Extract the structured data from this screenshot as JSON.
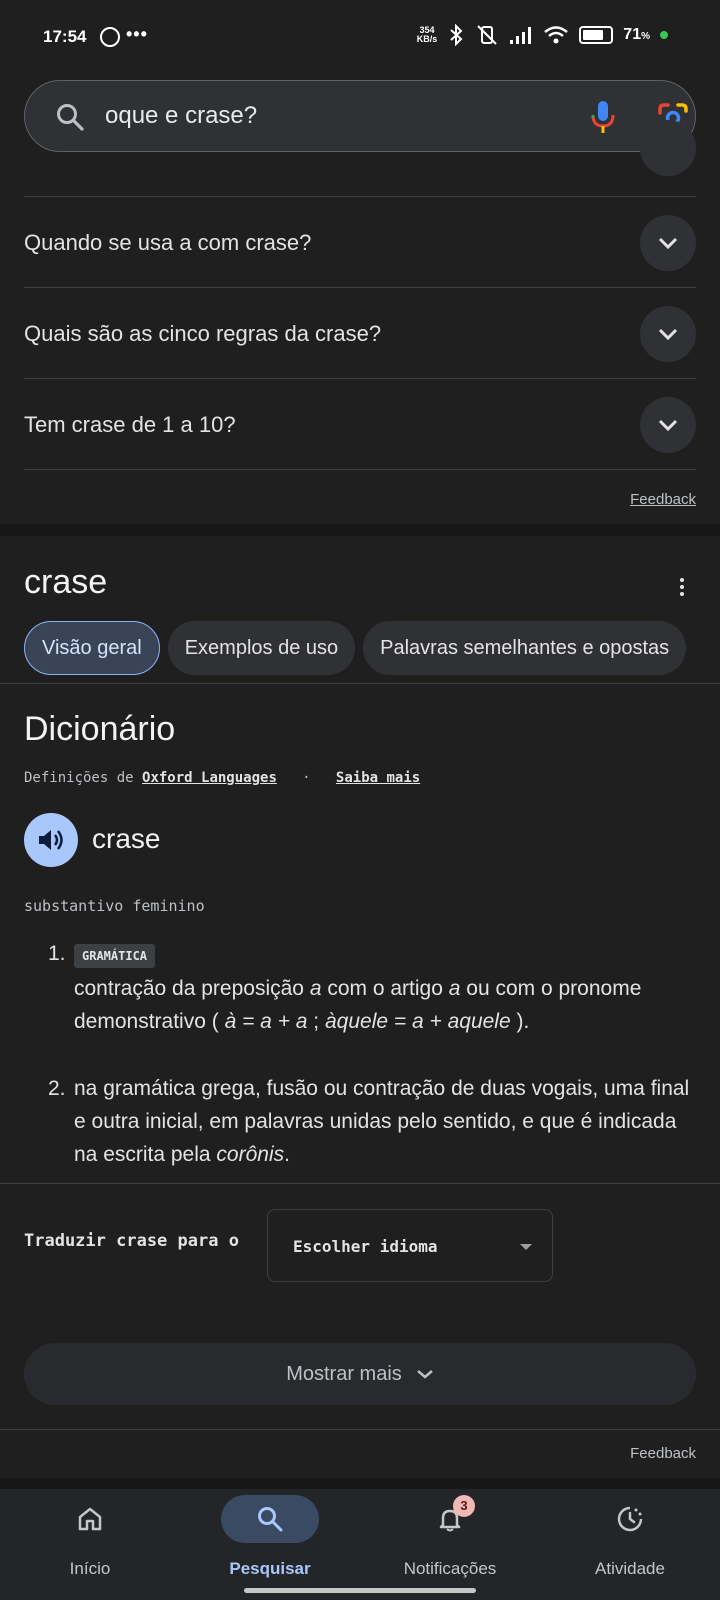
{
  "status_bar": {
    "time": "17:54",
    "dots": "•••",
    "speed_value": "354",
    "speed_unit": "KB/s",
    "battery_pct": "71",
    "battery_unit": "%"
  },
  "search": {
    "query": "oque e crase?"
  },
  "faq": {
    "items": [
      {
        "question": "Quando se usa a com crase?"
      },
      {
        "question": "Quais são as cinco regras da crase?"
      },
      {
        "question": "Tem crase de 1 a 10?"
      }
    ],
    "feedback_label": "Feedback"
  },
  "dictionary_card": {
    "title": "crase",
    "chips": [
      {
        "label": "Visão geral",
        "active": true
      },
      {
        "label": "Exemplos de uso",
        "active": false
      },
      {
        "label": "Palavras semelhantes e opostas",
        "active": false
      }
    ],
    "heading": "Dicionário",
    "source_prefix": "Definições de",
    "source_name": "Oxford Languages",
    "source_separator": "·",
    "learn_more": "Saiba mais",
    "headword": "crase",
    "part_of_speech": "substantivo feminino",
    "senses": [
      {
        "number": "1.",
        "badge": "GRAMÁTICA",
        "text_a": "contração da preposição ",
        "it_a": "a",
        "text_b": " com o artigo ",
        "it_b": "a",
        "text_c": " ou com o pronome demonstrativo ( ",
        "it_c": "à = a + a",
        "text_d": " ; ",
        "it_d": "àquele = a + aquele",
        "text_e": " )."
      },
      {
        "number": "2.",
        "text_a": "na gramática grega, fusão ou contração de duas vogais, uma final e outra inicial, em palavras unidas pelo sentido, e que é indicada na escrita pela ",
        "it_a": "corônis",
        "text_b": "."
      }
    ],
    "translate_label": "Traduzir crase para o",
    "translate_select": "Escolher idioma",
    "show_more": "Mostrar mais",
    "feedback_label": "Feedback"
  },
  "bottom_nav": {
    "items": [
      {
        "label": "Início",
        "icon": "home-icon",
        "active": false
      },
      {
        "label": "Pesquisar",
        "icon": "search-icon",
        "active": true
      },
      {
        "label": "Notificações",
        "icon": "bell-icon",
        "active": false,
        "badge": "3"
      },
      {
        "label": "Atividade",
        "icon": "activity-icon",
        "active": false
      }
    ]
  },
  "colors": {
    "background": "#1f1f1f",
    "accent": "#a8c7fa",
    "chip_active": "#394457"
  }
}
